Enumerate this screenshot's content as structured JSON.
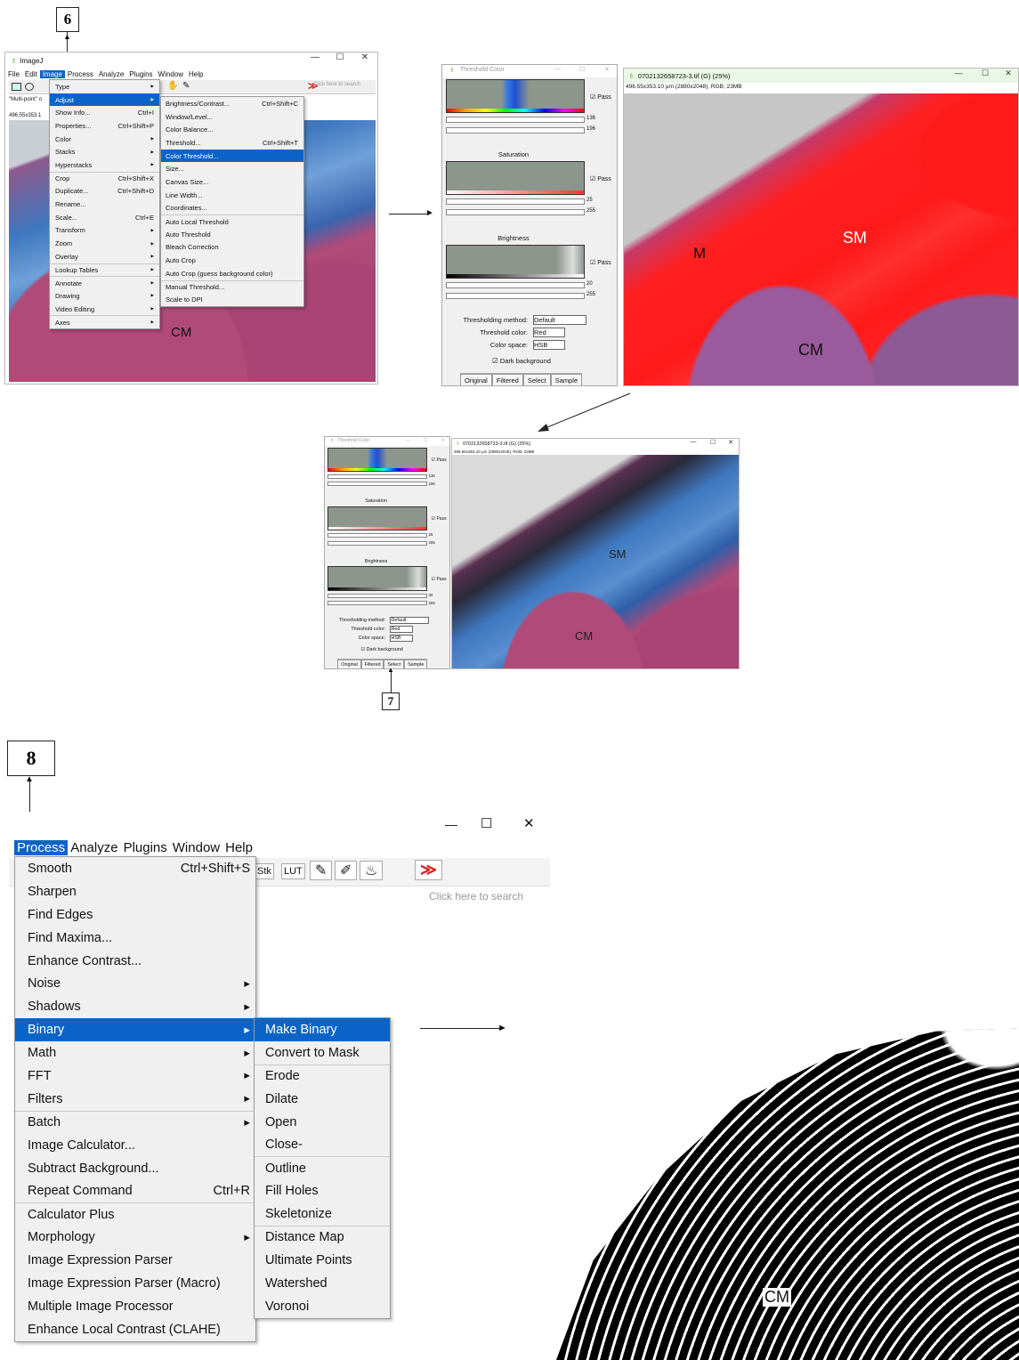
{
  "steps": {
    "s6": "6",
    "s7": "7",
    "s8": "8"
  },
  "imagej_window": {
    "title": "ImageJ",
    "win_min": "—",
    "win_max": "☐",
    "win_close": "✕",
    "menus": [
      "File",
      "Edit",
      "Image",
      "Process",
      "Analyze",
      "Plugins",
      "Window",
      "Help"
    ],
    "status": "\"Multi-point\" o",
    "dimension": "496.55x353.1",
    "search_placeholder": "Click here to search",
    "label_cm": "CM"
  },
  "image_menu": [
    {
      "label": "Type",
      "submenu": true
    },
    {
      "label": "Adjust",
      "submenu": true,
      "highlight": true
    },
    {
      "label": "Show Info...",
      "shortcut": "Ctrl+I"
    },
    {
      "label": "Properties...",
      "shortcut": "Ctrl+Shift+P"
    },
    {
      "label": "Color",
      "submenu": true
    },
    {
      "label": "Stacks",
      "submenu": true
    },
    {
      "label": "Hyperstacks",
      "submenu": true
    },
    {
      "label": "Crop",
      "shortcut": "Ctrl+Shift+X",
      "sep": true
    },
    {
      "label": "Duplicate...",
      "shortcut": "Ctrl+Shift+D"
    },
    {
      "label": "Rename..."
    },
    {
      "label": "Scale...",
      "shortcut": "Ctrl+E"
    },
    {
      "label": "Transform",
      "submenu": true
    },
    {
      "label": "Zoom",
      "submenu": true
    },
    {
      "label": "Overlay",
      "submenu": true
    },
    {
      "label": "Lookup Tables",
      "submenu": true,
      "sep": true
    },
    {
      "label": "Annotate",
      "submenu": true,
      "sep": true
    },
    {
      "label": "Drawing",
      "submenu": true
    },
    {
      "label": "Video Editing",
      "submenu": true
    },
    {
      "label": "Axes",
      "submenu": true,
      "sep": true
    }
  ],
  "adjust_menu": [
    {
      "label": "Brightness/Contrast...",
      "shortcut": "Ctrl+Shift+C"
    },
    {
      "label": "Window/Level..."
    },
    {
      "label": "Color Balance..."
    },
    {
      "label": "Threshold...",
      "shortcut": "Ctrl+Shift+T"
    },
    {
      "label": "Color Threshold...",
      "highlight": true
    },
    {
      "label": "Size..."
    },
    {
      "label": "Canvas Size..."
    },
    {
      "label": "Line Width..."
    },
    {
      "label": "Coordinates..."
    },
    {
      "label": "Auto Local Threshold",
      "sep": true
    },
    {
      "label": "Auto Threshold"
    },
    {
      "label": "Bleach Correction"
    },
    {
      "label": "Auto Crop"
    },
    {
      "label": "Auto Crop (guess background color)"
    },
    {
      "label": "Manual Threshold...",
      "sep": true
    },
    {
      "label": "Scale to DPI"
    }
  ],
  "threshold_panel": {
    "title": "Threshold Color",
    "pass": "Pass",
    "hue_min": "136",
    "hue_max": "196",
    "saturation_label": "Saturation",
    "sat_min": "25",
    "sat_max": "255",
    "brightness_label": "Brightness",
    "bri_min": "20",
    "bri_max": "255",
    "method_label": "Thresholding method:",
    "method_value": "Default",
    "color_label": "Threshold color:",
    "color_value": "Red",
    "space_label": "Color space:",
    "space_value": "HSB",
    "dark_bg": "Dark background",
    "buttons": [
      "Original",
      "Filtered",
      "Select",
      "Sample"
    ]
  },
  "image_window": {
    "title": "0702132658723-3.tif (G) (25%)",
    "info": "496.55x353.10 µm (2880x2048); RGB; 23MB",
    "label_m": "M",
    "label_sm": "SM",
    "label_cm": "CM"
  },
  "process_menubar": [
    "Process",
    "Analyze",
    "Plugins",
    "Window",
    "Help"
  ],
  "process_toolbar": {
    "stk": "Stk",
    "lut": "LUT",
    "search_placeholder": "Click here to search"
  },
  "process_menu": [
    {
      "label": "Smooth",
      "shortcut": "Ctrl+Shift+S"
    },
    {
      "label": "Sharpen"
    },
    {
      "label": "Find Edges"
    },
    {
      "label": "Find Maxima..."
    },
    {
      "label": "Enhance Contrast..."
    },
    {
      "label": "Noise",
      "submenu": true
    },
    {
      "label": "Shadows",
      "submenu": true
    },
    {
      "label": "Binary",
      "submenu": true,
      "highlight": true
    },
    {
      "label": "Math",
      "submenu": true
    },
    {
      "label": "FFT",
      "submenu": true
    },
    {
      "label": "Filters",
      "submenu": true
    },
    {
      "label": "Batch",
      "submenu": true,
      "sep": true
    },
    {
      "label": "Image Calculator..."
    },
    {
      "label": "Subtract Background..."
    },
    {
      "label": "Repeat Command",
      "shortcut": "Ctrl+R"
    },
    {
      "label": "Calculator Plus",
      "sep": true
    },
    {
      "label": "Morphology",
      "submenu": true
    },
    {
      "label": "Image Expression Parser"
    },
    {
      "label": "Image Expression Parser (Macro)"
    },
    {
      "label": "Multiple Image Processor"
    },
    {
      "label": "Enhance Local Contrast (CLAHE)"
    }
  ],
  "binary_menu": [
    {
      "label": "Make Binary",
      "highlight": true
    },
    {
      "label": "Convert to Mask"
    },
    {
      "label": "Erode",
      "sep": true
    },
    {
      "label": "Dilate"
    },
    {
      "label": "Open"
    },
    {
      "label": "Close-"
    },
    {
      "label": "Outline",
      "sep": true
    },
    {
      "label": "Fill Holes"
    },
    {
      "label": "Skeletonize"
    },
    {
      "label": "Distance Map",
      "sep": true
    },
    {
      "label": "Ultimate Points"
    },
    {
      "label": "Watershed"
    },
    {
      "label": "Voronoi"
    }
  ],
  "binary_result": {
    "label_cm": "CM"
  },
  "colors": {
    "highlight": "#0a64c8",
    "threshold_red": "#ff1a1a",
    "tissue_pink": "#b04a78",
    "tissue_blue": "#3f78c0"
  }
}
